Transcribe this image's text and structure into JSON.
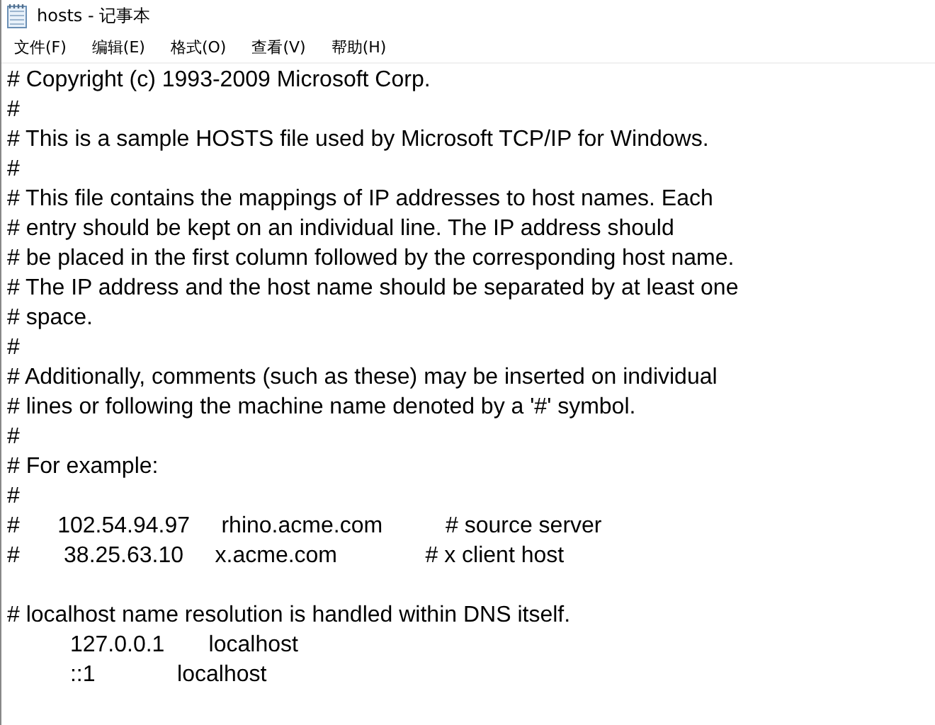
{
  "window": {
    "title": "hosts - 记事本"
  },
  "menu": [
    "文件(F)",
    "编辑(E)",
    "格式(O)",
    "查看(V)",
    "帮助(H)"
  ],
  "editor": {
    "lines": [
      {
        "kind": "text",
        "text": "# Copyright (c) 1993-2009 Microsoft Corp."
      },
      {
        "kind": "text",
        "text": "#"
      },
      {
        "kind": "text",
        "text": "# This is a sample HOSTS file used by Microsoft TCP/IP for Windows."
      },
      {
        "kind": "text",
        "text": "#"
      },
      {
        "kind": "text",
        "text": "# This file contains the mappings of IP addresses to host names. Each"
      },
      {
        "kind": "text",
        "text": "# entry should be kept on an individual line. The IP address should"
      },
      {
        "kind": "text",
        "text": "# be placed in the first column followed by the corresponding host name."
      },
      {
        "kind": "text",
        "text": "# The IP address and the host name should be separated by at least one"
      },
      {
        "kind": "text",
        "text": "# space."
      },
      {
        "kind": "text",
        "text": "#"
      },
      {
        "kind": "text",
        "text": "# Additionally, comments (such as these) may be inserted on individual"
      },
      {
        "kind": "text",
        "text": "# lines or following the machine name denoted by a '#' symbol."
      },
      {
        "kind": "text",
        "text": "#"
      },
      {
        "kind": "text",
        "text": "# For example:"
      },
      {
        "kind": "text",
        "text": "#"
      },
      {
        "kind": "text",
        "text": "#      102.54.94.97     rhino.acme.com          # source server"
      },
      {
        "kind": "text",
        "text": "#       38.25.63.10     x.acme.com              # x client host"
      },
      {
        "kind": "blank"
      },
      {
        "kind": "text",
        "text": "# localhost name resolution is handled within DNS itself."
      },
      {
        "kind": "text",
        "text": "\t127.0.0.1       localhost"
      },
      {
        "kind": "text",
        "text": "\t::1             localhost"
      }
    ]
  }
}
